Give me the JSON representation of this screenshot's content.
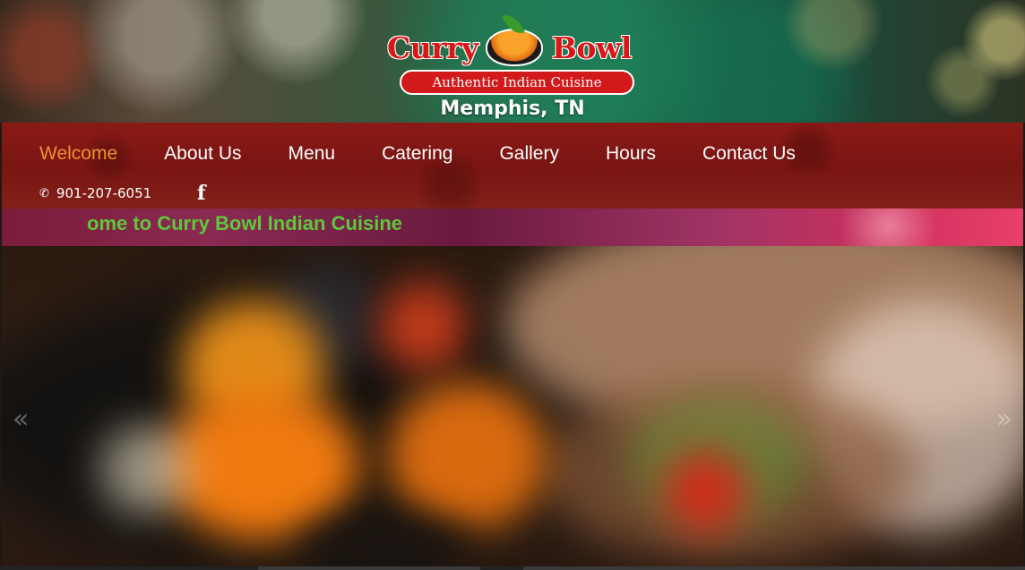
{
  "brand": {
    "word_left": "Curry",
    "word_right": "Bowl",
    "tagline": "Authentic Indian Cuisine",
    "city": "Memphis, TN",
    "logo_red": "#d81818"
  },
  "nav": {
    "items": [
      {
        "label": "Welcome",
        "active": true
      },
      {
        "label": "About Us",
        "active": false
      },
      {
        "label": "Menu",
        "active": false
      },
      {
        "label": "Catering",
        "active": false
      },
      {
        "label": "Gallery",
        "active": false
      },
      {
        "label": "Hours",
        "active": false
      },
      {
        "label": "Contact Us",
        "active": false
      }
    ],
    "active_color": "#f0902a",
    "bar_color": "#7a1512"
  },
  "contact": {
    "phone_icon": "phone-icon",
    "phone": "901-207-6051",
    "social_icon": "facebook-icon"
  },
  "marquee": {
    "text": "ome to Curry Bowl Indian Cuisine",
    "text_color": "#5ec83a"
  },
  "slider": {
    "prev_icon": "chevron-double-left-icon",
    "next_icon": "chevron-double-right-icon",
    "prev_glyph": "«",
    "next_glyph": "»"
  }
}
